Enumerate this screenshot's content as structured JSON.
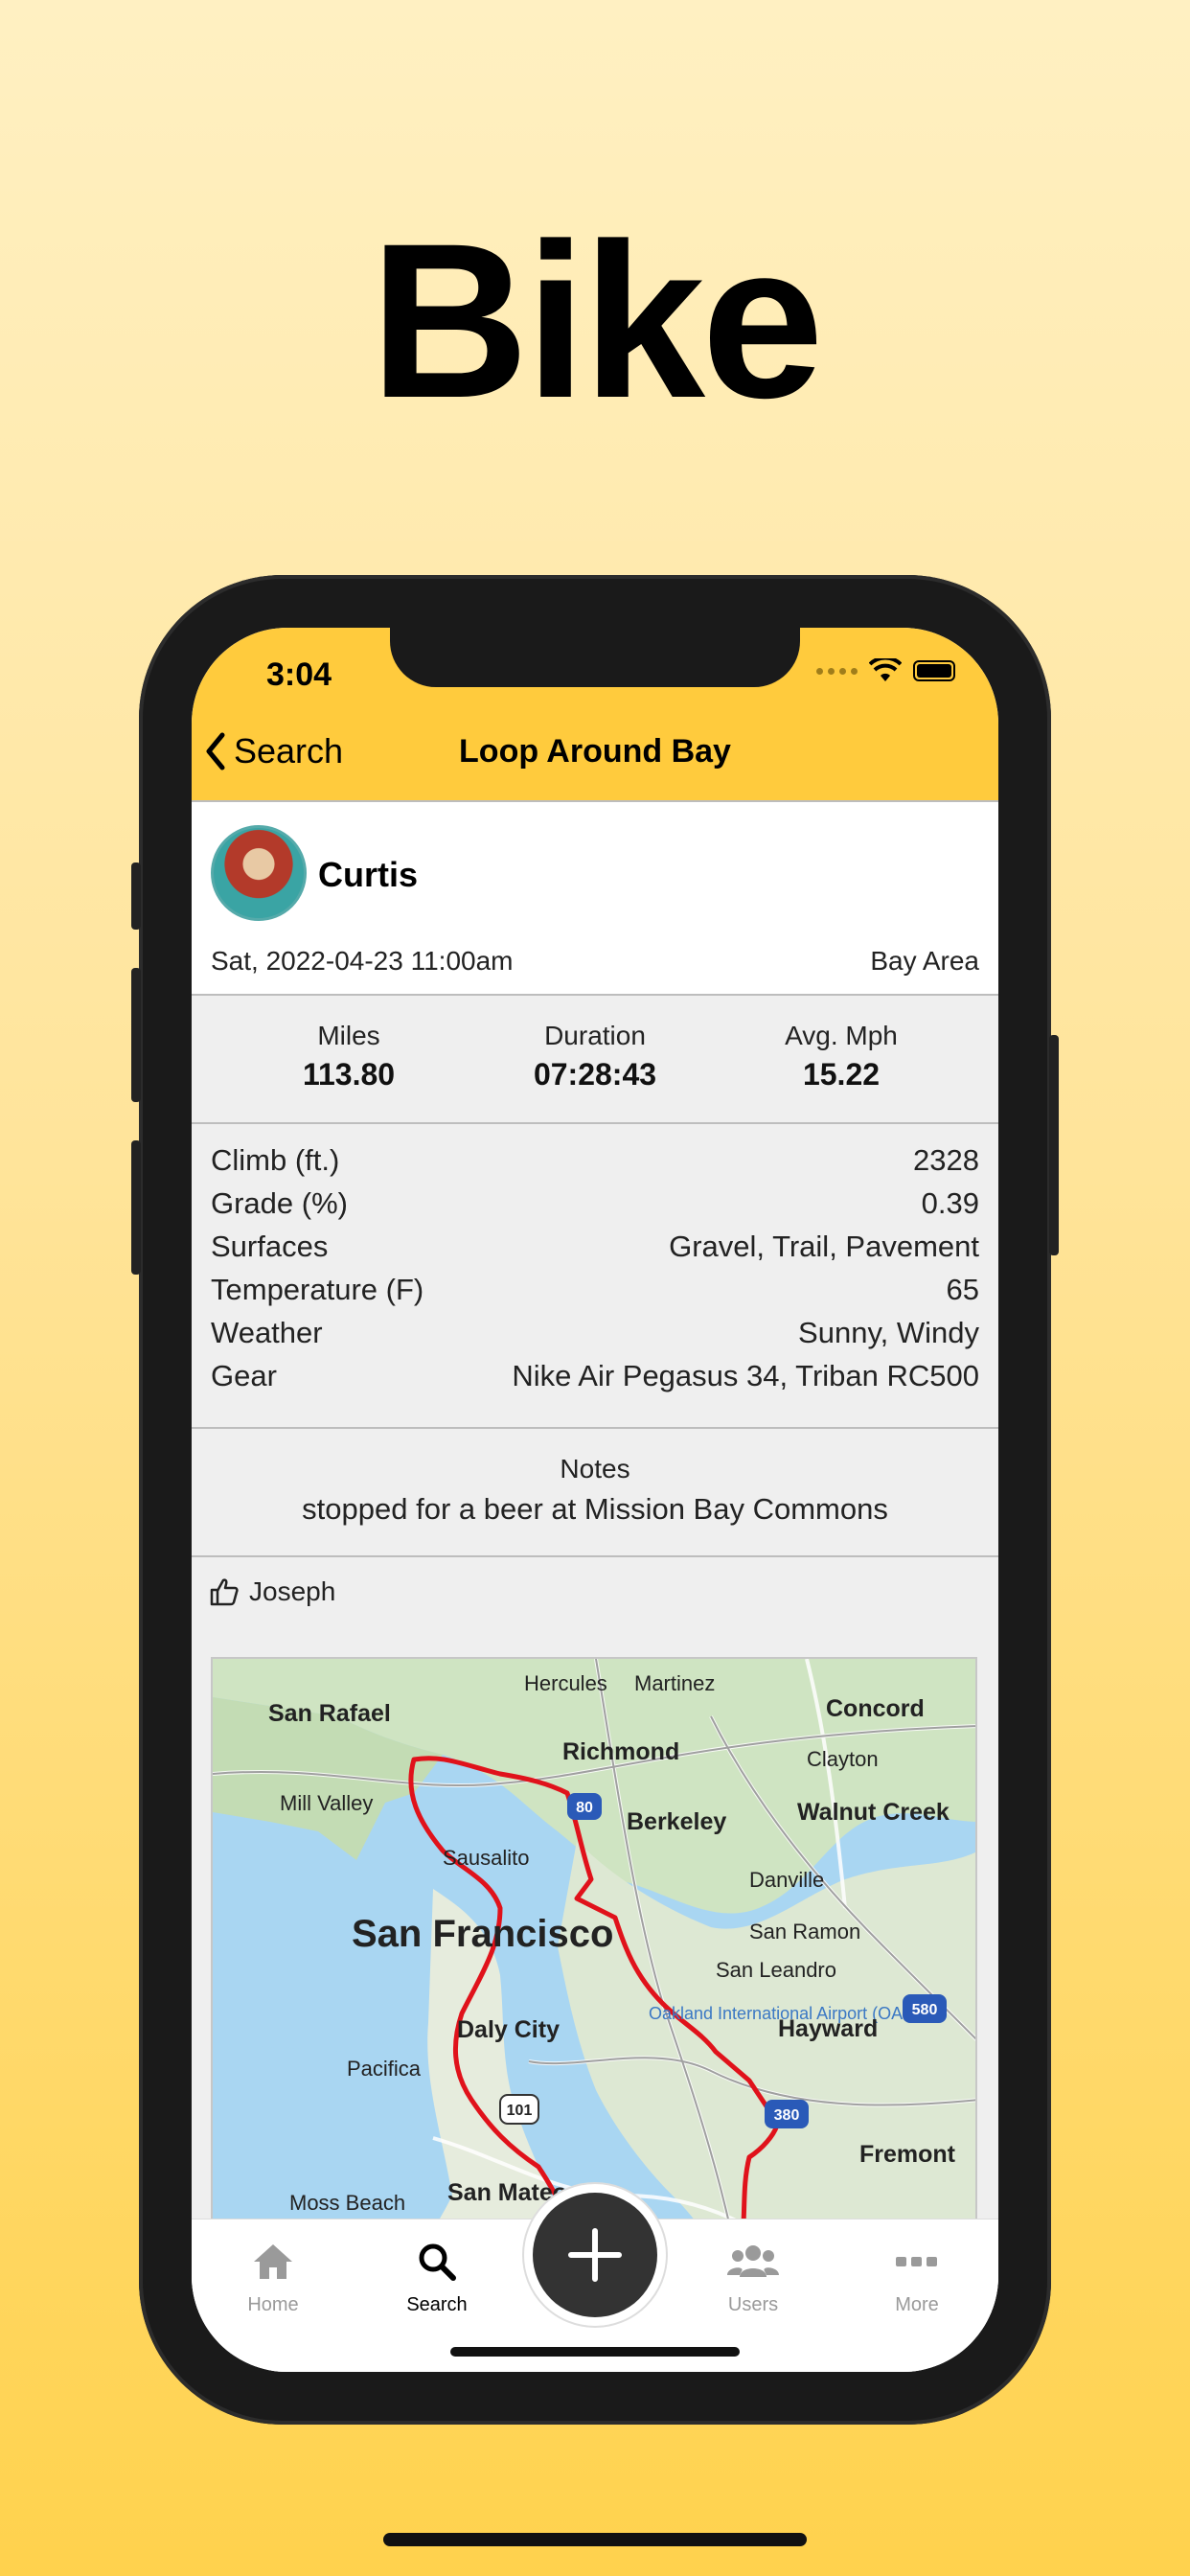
{
  "headline": "Bike",
  "status_bar": {
    "time": "3:04"
  },
  "nav": {
    "back_label": "Search",
    "title": "Loop Around Bay"
  },
  "activity": {
    "user": "Curtis",
    "date": "Sat, 2022-04-23 11:00am",
    "location": "Bay Area",
    "stats": [
      {
        "label": "Miles",
        "value": "113.80"
      },
      {
        "label": "Duration",
        "value": "07:28:43"
      },
      {
        "label": "Avg. Mph",
        "value": "15.22"
      }
    ],
    "details": [
      {
        "label": "Climb (ft.)",
        "value": "2328"
      },
      {
        "label": "Grade (%)",
        "value": "0.39"
      },
      {
        "label": "Surfaces",
        "value": "Gravel, Trail, Pavement"
      },
      {
        "label": "Temperature (F)",
        "value": "65"
      },
      {
        "label": "Weather",
        "value": "Sunny, Windy"
      },
      {
        "label": "Gear",
        "value": "Nike Air Pegasus 34, Triban RC500"
      }
    ],
    "notes_label": "Notes",
    "notes": "stopped for a beer at Mission Bay Commons",
    "likes": "Joseph"
  },
  "map": {
    "places": [
      "Hercules",
      "Martinez",
      "Concord",
      "San Rafael",
      "Richmond",
      "Clayton",
      "Mill Valley",
      "Berkeley",
      "Walnut Creek",
      "Sausalito",
      "Danville",
      "San Francisco",
      "San Ramon",
      "San Leandro",
      "Oakland International Airport (OAK)",
      "Daly City",
      "Hayward",
      "Pacifica",
      "Fremont",
      "Moss Beach",
      "San Mateo"
    ],
    "shields": [
      "80",
      "580",
      "380",
      "101"
    ],
    "route_color": "#e0121b"
  },
  "tabs": [
    {
      "label": "Home",
      "icon": "home-icon",
      "active": false
    },
    {
      "label": "Search",
      "icon": "search-icon",
      "active": true
    },
    {
      "label": "Users",
      "icon": "users-icon",
      "active": false
    },
    {
      "label": "More",
      "icon": "more-icon",
      "active": false
    }
  ],
  "colors": {
    "accent": "#ffcb3d",
    "fab": "#333333"
  }
}
